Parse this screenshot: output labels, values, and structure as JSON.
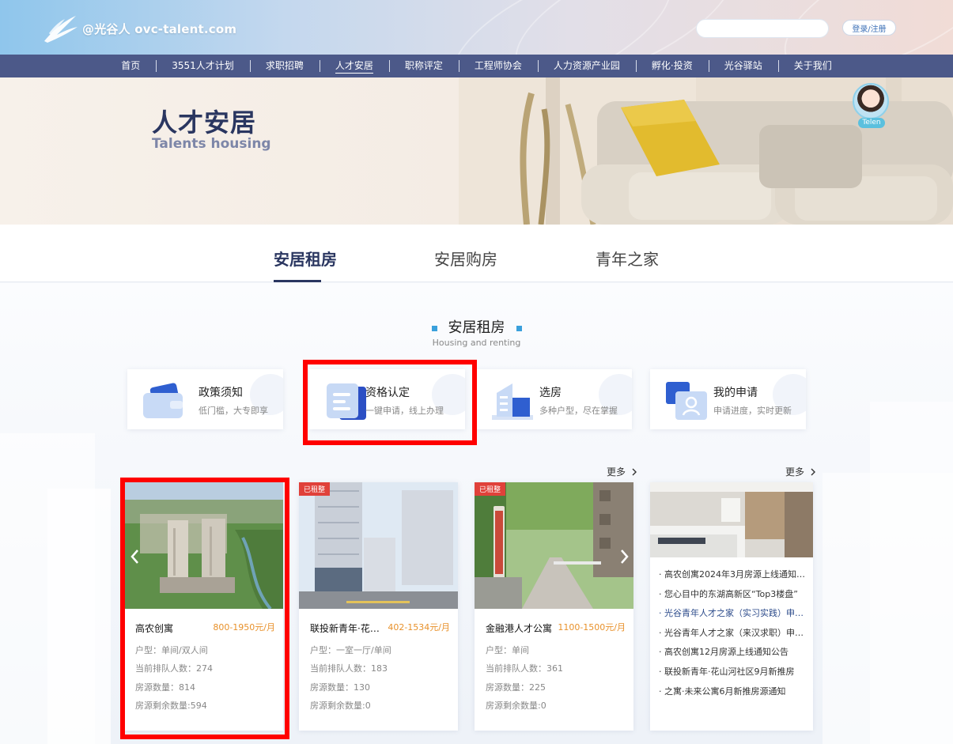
{
  "header": {
    "logo_text": "@光谷人 ovc-talent.com",
    "search_placeholder": "",
    "login_label": "登录/注册"
  },
  "nav": {
    "items": [
      "首页",
      "3551人才计划",
      "求职招聘",
      "人才安居",
      "职称评定",
      "工程师协会",
      "人力资源产业园",
      "孵化·投资",
      "光谷驿站",
      "关于我们"
    ],
    "active_index": 3
  },
  "banner": {
    "title": "人才安居",
    "subtitle": "Talents housing",
    "avatar_label": "Telen"
  },
  "tabs": {
    "items": [
      "安居租房",
      "安居购房",
      "青年之家"
    ],
    "active_index": 0
  },
  "section": {
    "title": "安居租房",
    "subtitle": "Housing and renting"
  },
  "services": [
    {
      "title": "政策须知",
      "desc": "低门槛，大专即享",
      "icon": "wallet-icon"
    },
    {
      "title": "资格认定",
      "desc": "一键申请，线上办理",
      "icon": "document-icon"
    },
    {
      "title": "选房",
      "desc": "多种户型，尽在掌握",
      "icon": "building-icon"
    },
    {
      "title": "我的申请",
      "desc": "申请进度，实时更新",
      "icon": "user-application-icon"
    }
  ],
  "more_label": "更多",
  "listings": [
    {
      "name": "高农创寓",
      "price": "800-1950元/月",
      "badge": "",
      "type": "户型：单间/双人间",
      "queue": "当前排队人数：274",
      "count": "房源数量：814",
      "remaining": "房源剩余数量:594"
    },
    {
      "name": "联投新青年·花…",
      "price": "402-1534元/月",
      "badge": "已租整",
      "type": "户型：一室一厅/单间",
      "queue": "当前排队人数：183",
      "count": "房源数量：130",
      "remaining": "房源剩余数量:0"
    },
    {
      "name": "金融港人才公寓",
      "price": "1100-1500元/月",
      "badge": "已租整",
      "type": "户型：单间",
      "queue": "当前排队人数：361",
      "count": "房源数量：225",
      "remaining": "房源剩余数量:0"
    }
  ],
  "news": [
    "· 高农创寓2024年3月房源上线通知…",
    "· 您心目中的东湖高新区“Top3楼盘”",
    "· 光谷青年人才之家（实习实践）申…",
    "· 光谷青年人才之家（来汉求职）申…",
    "· 高农创寓12月房源上线通知公告",
    "· 联投新青年·花山河社区9月新推房",
    "· 之寓·未来公寓6月新推房源通知"
  ],
  "colors": {
    "nav_bg": "#4c5989",
    "title_navy": "#2a3660",
    "price_orange": "#e8912a",
    "badge_red": "#e0413a",
    "highlight_red": "#ff0000"
  }
}
